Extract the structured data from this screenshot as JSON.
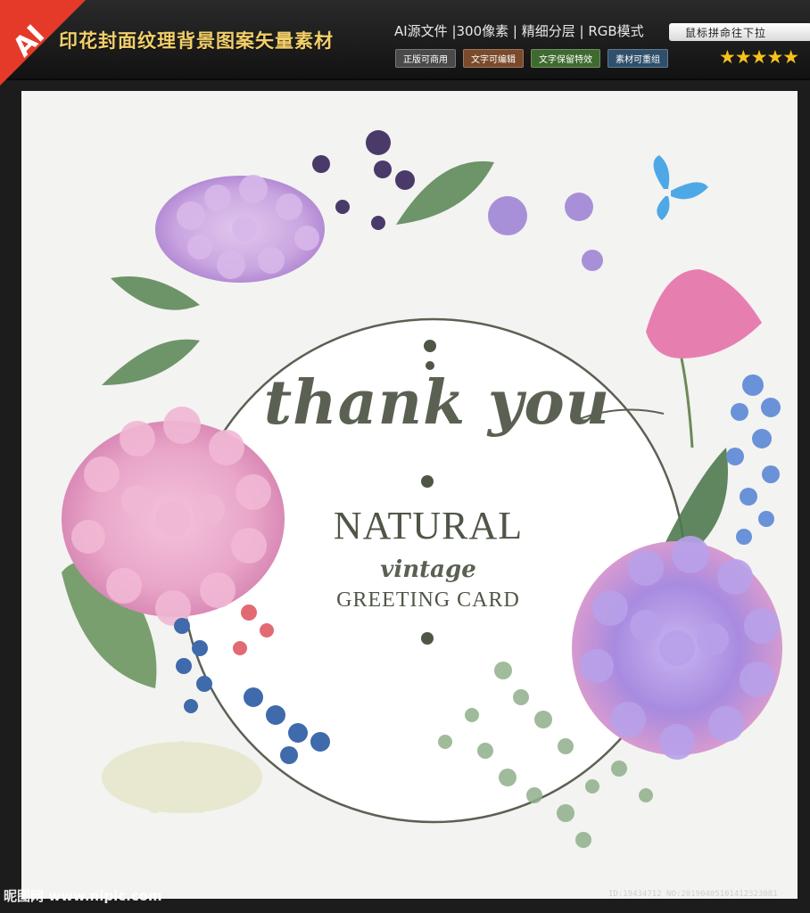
{
  "banner": {
    "corner_badge": "AI",
    "title": "印花封面纹理背景图案矢量素材",
    "spec": "AI源文件 |300像素 | 精细分层 | RGB模式",
    "tags": [
      "正版可商用",
      "文字可编辑",
      "文字保留特效",
      "素材可重组"
    ],
    "scroll_tip": "鼠标拼命往下拉",
    "stars": "★★★★★"
  },
  "card": {
    "headline": "thank you",
    "line1": "NATURAL",
    "line2": "vintage",
    "line3": "GREETING CARD"
  },
  "watermarks": {
    "left": "昵图网 www.nipic.com",
    "right": "ID:19434712 NO:20190405101412323081"
  },
  "colors": {
    "text": "#4f5647",
    "accent_red": "#e53a2a",
    "gold": "#f2cf6a",
    "hydrangea_pink": "#e9a6c8",
    "hydrangea_purple": "#b99be0",
    "leaf_green": "#5f8a5a"
  }
}
